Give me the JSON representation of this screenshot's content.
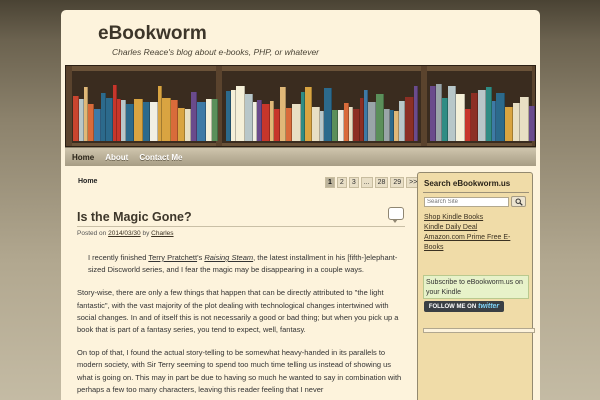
{
  "header": {
    "site_title": "eBookworm",
    "site_description": "Charles Reace's blog about e-books, PHP, or whatever"
  },
  "nav": {
    "items": [
      {
        "label": "Home",
        "active": true
      },
      {
        "label": "About",
        "active": false
      },
      {
        "label": "Contact Me",
        "active": false
      }
    ]
  },
  "breadcrumb": "Home",
  "pagination": [
    "1",
    "2",
    "3",
    "...",
    "28",
    "29",
    ">>"
  ],
  "post": {
    "title": "Is the Magic Gone?",
    "meta_posted_on": "Posted on",
    "date": "2014/03/30",
    "meta_by": "by",
    "author": "Charles",
    "p1_a": "I recently finished ",
    "p1_link1": "Terry Pratchett",
    "p1_b": "'s ",
    "p1_link2": "Raising Steam",
    "p1_c": ", the latest installment in his [fifth-]elephant-sized Discworld series, and I fear the magic may be disappearing in a couple ways.",
    "p2": "Story-wise, there are only a few things that happen that can be directly attributed to \"the light fantastic\", with the vast majority of the plot dealing with technological changes intertwined with social changes. In and of itself this is not necessarily a good or bad thing; but when you pick up a book that is part of a fantasy series, you tend to expect, well, fantasy.",
    "p3": "On top of that, I found the actual story-telling to be somewhat heavy-handed in its parallels to modern society, with Sir Terry seeming to spend too much time telling us instead of showing us what is going on. This may in part be due to having so much he wanted to say in combination with perhaps a few too many characters, leaving this reader feeling that I never"
  },
  "sidebar": {
    "search_title": "Search eBookworm.us",
    "search_placeholder": "Search Site",
    "links": [
      "Shop Kindle Books",
      "Kindle Daily Deal",
      "Amazon.com Prime Free E-Books"
    ],
    "subscribe_text": "Subscribe to eBookworm.us on your Kindle",
    "follow_label": "FOLLOW ME ON",
    "follow_brand": "twitter"
  },
  "colors": {
    "page_bg": "#fdf3dc",
    "sidebar_bg": "#f0dca8",
    "subscribe_bg": "#e7f2c9",
    "nav_bar": "#b8ae96",
    "title_text": "#3d362a"
  }
}
